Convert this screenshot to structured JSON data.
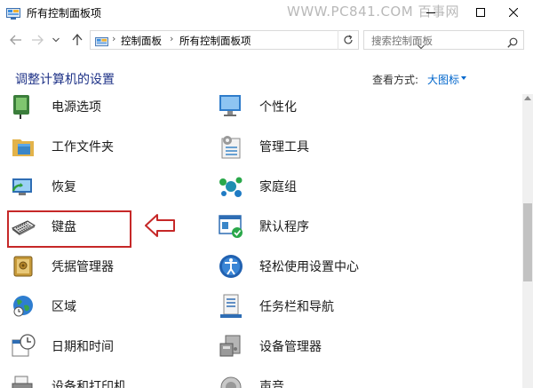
{
  "window": {
    "title": "所有控制面板项",
    "watermark": "WWW.PC841.COM 百事网"
  },
  "nav": {
    "breadcrumb": [
      "控制面板",
      "所有控制面板项"
    ],
    "search_placeholder": "搜索控制面板"
  },
  "header": {
    "heading": "调整计算机的设置",
    "view_by_label": "查看方式:",
    "view_by_value": "大图标"
  },
  "items": [
    {
      "label": "电源选项",
      "icon": "power-options-icon"
    },
    {
      "label": "个性化",
      "icon": "personalization-icon"
    },
    {
      "label": "工作文件夹",
      "icon": "work-folders-icon"
    },
    {
      "label": "管理工具",
      "icon": "admin-tools-icon"
    },
    {
      "label": "恢复",
      "icon": "recovery-icon"
    },
    {
      "label": "家庭组",
      "icon": "homegroup-icon"
    },
    {
      "label": "键盘",
      "icon": "keyboard-icon"
    },
    {
      "label": "默认程序",
      "icon": "default-programs-icon"
    },
    {
      "label": "凭据管理器",
      "icon": "credential-manager-icon"
    },
    {
      "label": "轻松使用设置中心",
      "icon": "ease-of-access-icon"
    },
    {
      "label": "区域",
      "icon": "region-icon"
    },
    {
      "label": "任务栏和导航",
      "icon": "taskbar-navigation-icon"
    },
    {
      "label": "日期和时间",
      "icon": "date-time-icon"
    },
    {
      "label": "设备管理器",
      "icon": "device-manager-icon"
    },
    {
      "label": "设备和打印机",
      "icon": "devices-printers-icon"
    },
    {
      "label": "声音",
      "icon": "sound-icon"
    }
  ],
  "colors": {
    "heading": "#1e3287",
    "link": "#0066cc",
    "highlight": "#c62828"
  }
}
